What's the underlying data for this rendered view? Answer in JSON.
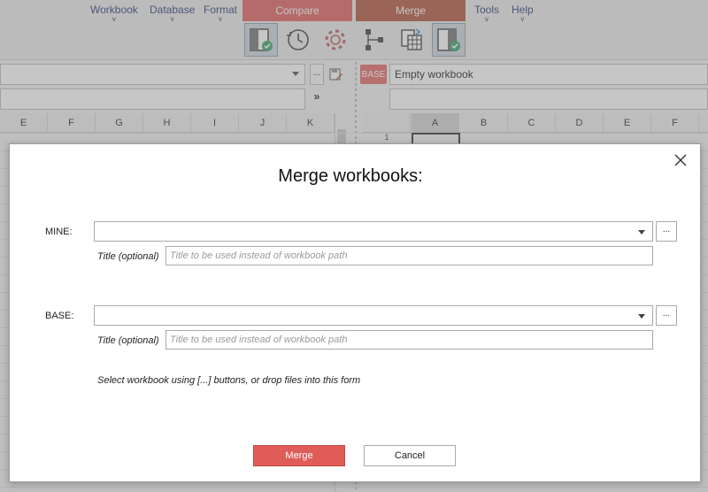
{
  "menu": {
    "items": [
      {
        "label": "Workbook",
        "chevron": "v"
      },
      {
        "label": "Database",
        "chevron": "v"
      },
      {
        "label": "Format",
        "chevron": "v"
      },
      {
        "label": "Tools",
        "chevron": "v"
      },
      {
        "label": "Help",
        "chevron": "v"
      }
    ]
  },
  "ribbon_tabs": {
    "compare": "Compare",
    "merge": "Merge"
  },
  "toolbar": {
    "icons": [
      "workbook-check-icon",
      "history-icon",
      "settings-gear-icon",
      "tree-diagram-icon",
      "copy-sheet-icon",
      "workbook-check-icon"
    ]
  },
  "formula_bar": {
    "dots": "...",
    "base_badge": "BASE",
    "right_value": "Empty workbook",
    "expand_glyph": "»"
  },
  "grid": {
    "left_columns": [
      "E",
      "F",
      "G",
      "H",
      "I",
      "J",
      "K"
    ],
    "right_columns": [
      "A",
      "B",
      "C",
      "D",
      "E",
      "F"
    ],
    "row_number": "1"
  },
  "dialog": {
    "title": "Merge workbooks:",
    "close_glyph": "×",
    "mine": {
      "label": "MINE:",
      "browse": "...",
      "title_label": "Title (optional)",
      "title_placeholder": "Title to be used instead of workbook path"
    },
    "base": {
      "label": "BASE:",
      "browse": "...",
      "title_label": "Title (optional)",
      "title_placeholder": "Title to be used instead of workbook path"
    },
    "hint": "Select workbook using [...] buttons, or drop files into this form",
    "merge_button": "Merge",
    "cancel_button": "Cancel"
  },
  "colors": {
    "compare_tab": "#e0625f",
    "merge_tab": "#b3563e",
    "merge_button": "#e05c58",
    "base_badge": "#e66b68",
    "menu_text": "#2f3f78"
  }
}
